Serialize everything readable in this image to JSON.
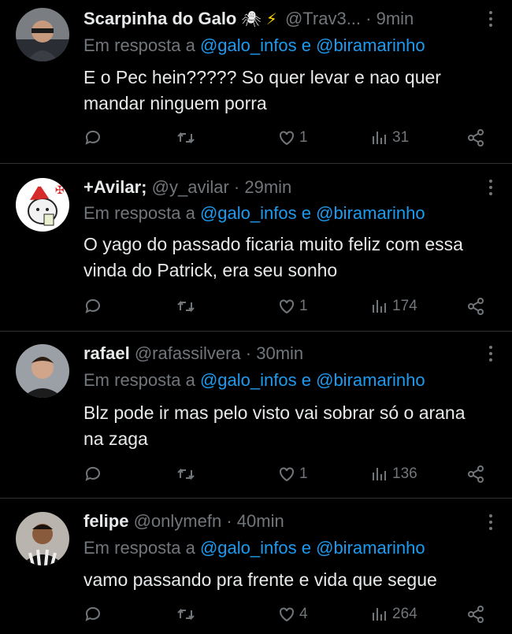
{
  "tweets": [
    {
      "name": "Scarpinha do Galo",
      "emoji1": "🕷",
      "emoji2": "⚡",
      "handle": "@Trav3...",
      "time": "· 9min",
      "reply_prefix": "Em resposta a",
      "mention1": "@galo_infos",
      "conj": "e",
      "mention2": "@biramarinho",
      "text": "E o Pec hein????? So quer levar e nao quer mandar ninguem porra",
      "likes": "1",
      "views": "31"
    },
    {
      "name": "+Avilar;",
      "handle": "@y_avilar",
      "time": "· 29min",
      "reply_prefix": "Em resposta a",
      "mention1": "@galo_infos",
      "conj": "e",
      "mention2": "@biramarinho",
      "text": "O yago do passado ficaria muito feliz com essa vinda do Patrick, era seu sonho",
      "likes": "1",
      "views": "174"
    },
    {
      "name": "rafael",
      "handle": "@rafassilvera",
      "time": "· 30min",
      "reply_prefix": "Em resposta a",
      "mention1": "@galo_infos",
      "conj": "e",
      "mention2": "@biramarinho",
      "text": "Blz pode ir mas pelo visto vai sobrar só o arana na zaga",
      "likes": "1",
      "views": "136"
    },
    {
      "name": "felipe",
      "handle": "@onlymefn",
      "time": "· 40min",
      "reply_prefix": "Em resposta a",
      "mention1": "@galo_infos",
      "conj": "e",
      "mention2": "@biramarinho",
      "text": "vamo passando pra frente e vida que segue",
      "likes": "4",
      "views": "264"
    }
  ],
  "icons": {
    "reply": "reply-icon",
    "retweet": "retweet-icon",
    "like": "heart-icon",
    "views": "views-icon",
    "share": "share-icon",
    "more": "more-icon"
  },
  "colors": {
    "background": "#000000",
    "text": "#e7e9ea",
    "secondary": "#71767b",
    "mention": "#1d9bf0",
    "divider": "#2f3336"
  }
}
